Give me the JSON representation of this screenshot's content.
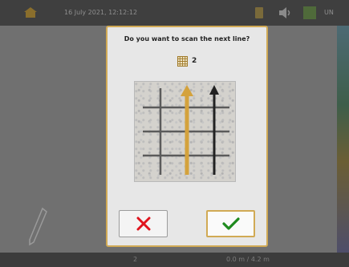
{
  "statusbar": {
    "datetime": "16 July 2021, 12:12:12",
    "unit": "UN"
  },
  "bottombar": {
    "line_count": "2",
    "dimensions": "0.0 m / 4.2 m"
  },
  "dialog": {
    "title": "Do you want to scan the next line?",
    "line_number": "2"
  },
  "icons": {
    "home": "home-icon",
    "battery": "battery-icon",
    "volume": "volume-icon",
    "grid_status": "grid-status-icon",
    "pen": "pen-icon",
    "grid": "grid-icon",
    "reject": "close-icon",
    "accept": "check-icon"
  },
  "colors": {
    "dialog_border": "#d1aa55",
    "reject": "#e0141e",
    "accept": "#1e8a1e",
    "scan_arrow": "#d4a23c"
  }
}
